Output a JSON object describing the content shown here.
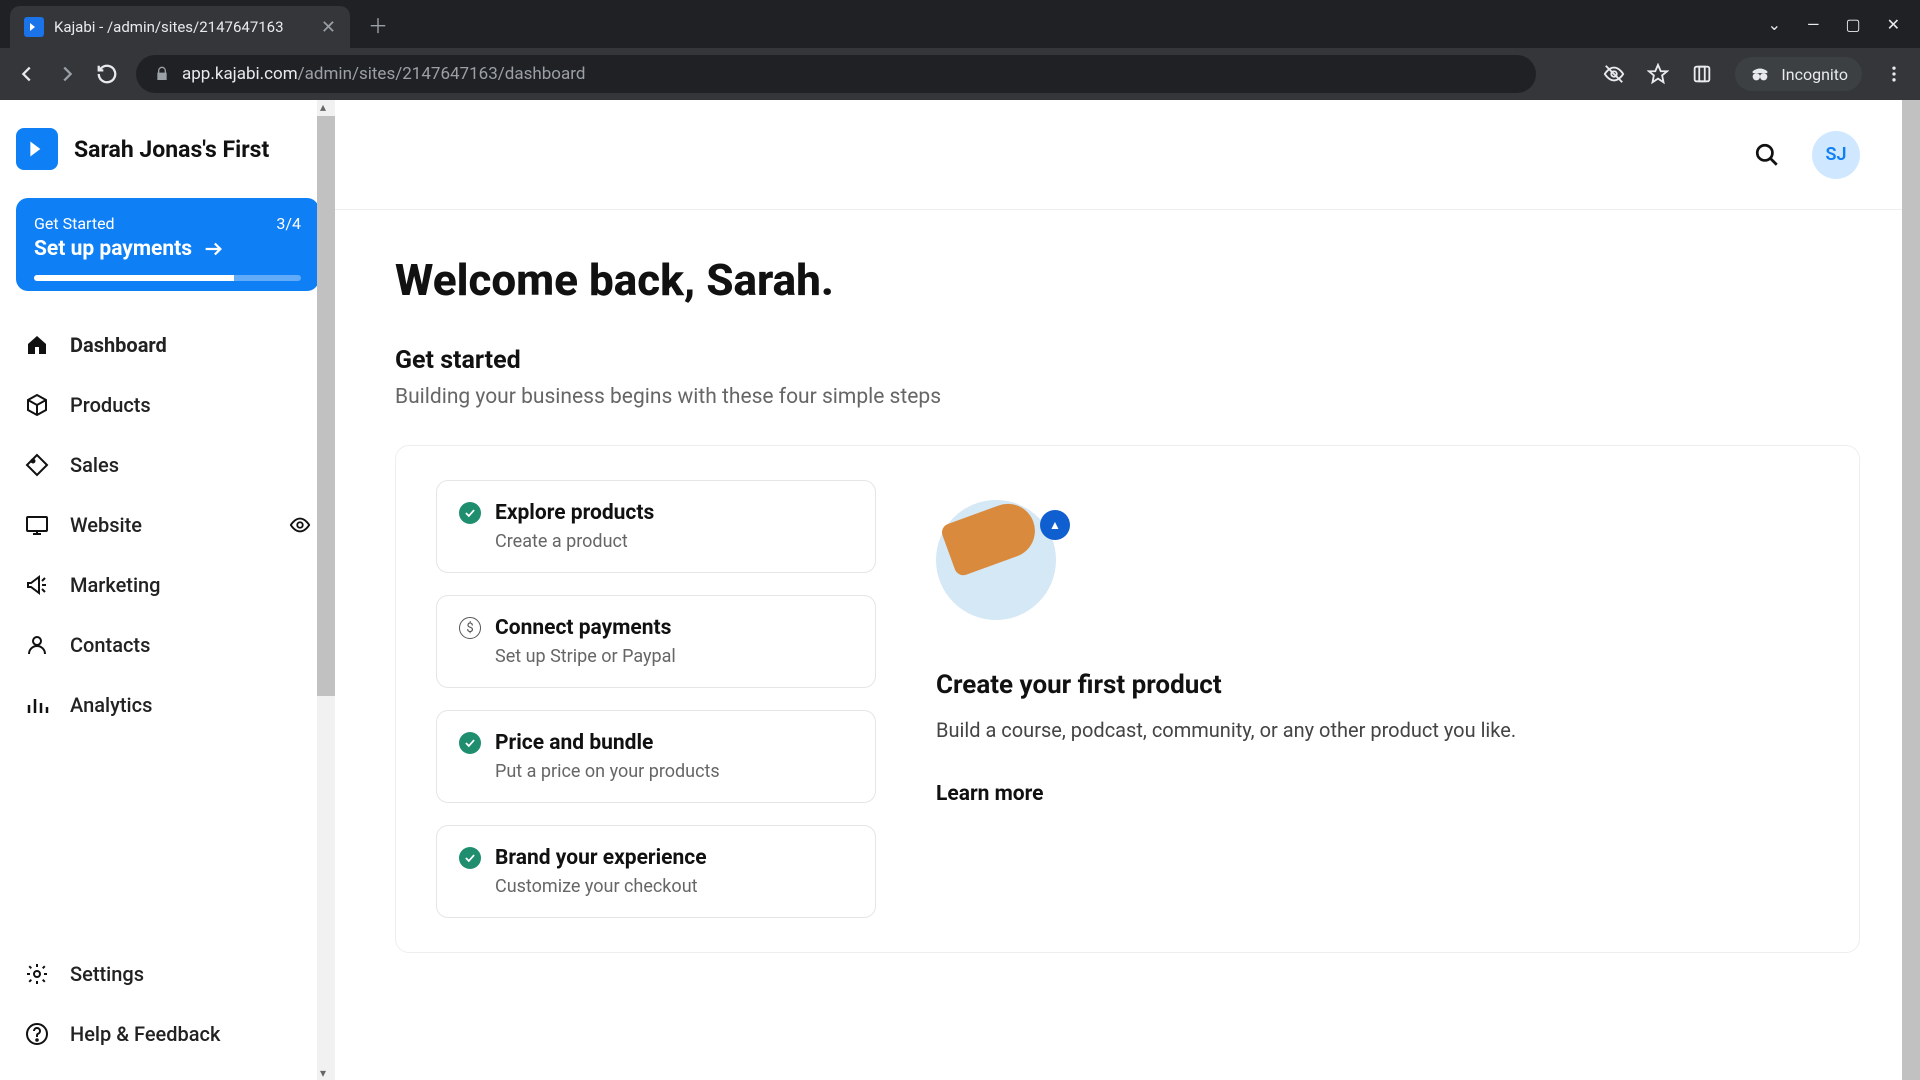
{
  "browser": {
    "tab_title": "Kajabi - /admin/sites/2147647163",
    "url_domain": "app.kajabi.com",
    "url_path": "/admin/sites/2147647163/dashboard",
    "incognito_label": "Incognito"
  },
  "brand": {
    "site_name": "Sarah Jonas's First"
  },
  "get_started_card": {
    "label": "Get Started",
    "progress_text": "3/4",
    "action": "Set up payments"
  },
  "nav": [
    {
      "key": "dashboard",
      "label": "Dashboard",
      "active": true
    },
    {
      "key": "products",
      "label": "Products"
    },
    {
      "key": "sales",
      "label": "Sales"
    },
    {
      "key": "website",
      "label": "Website",
      "trailing": "eye"
    },
    {
      "key": "marketing",
      "label": "Marketing"
    },
    {
      "key": "contacts",
      "label": "Contacts"
    },
    {
      "key": "analytics",
      "label": "Analytics"
    }
  ],
  "nav_footer": [
    {
      "key": "settings",
      "label": "Settings"
    },
    {
      "key": "help",
      "label": "Help & Feedback"
    }
  ],
  "header": {
    "avatar_initials": "SJ"
  },
  "main": {
    "welcome": "Welcome back, Sarah.",
    "section_title": "Get started",
    "section_sub": "Building your business begins with these four simple steps",
    "steps": [
      {
        "title": "Explore products",
        "sub": "Create a product",
        "done": true
      },
      {
        "title": "Connect payments",
        "sub": "Set up Stripe or Paypal",
        "done": false,
        "dollar": true
      },
      {
        "title": "Price and bundle",
        "sub": "Put a price on your products",
        "done": true
      },
      {
        "title": "Brand your experience",
        "sub": "Customize your checkout",
        "done": true
      }
    ],
    "promo": {
      "title": "Create your first product",
      "desc": "Build a course, podcast, community, or any other product you like.",
      "link": "Learn more"
    }
  }
}
